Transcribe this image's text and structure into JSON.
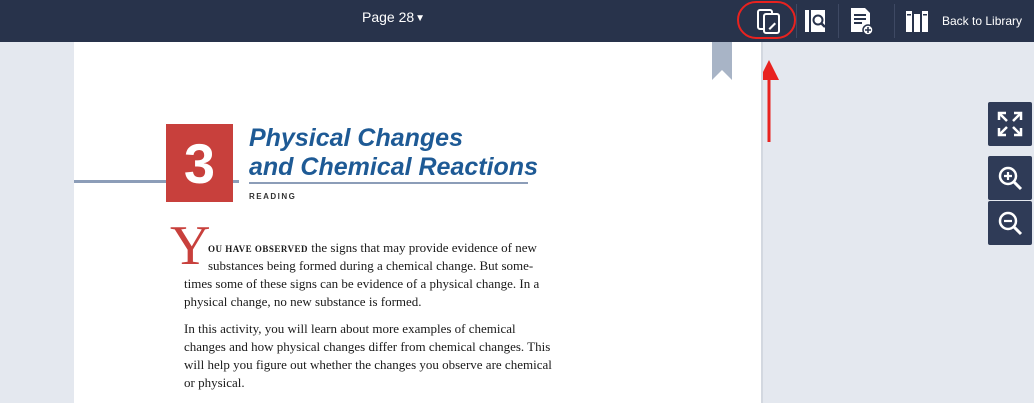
{
  "toolbar": {
    "page_label": "Page 28",
    "chevron": "⌄",
    "back_to_library": "Back to Library",
    "icons": [
      "annotations-icon",
      "search-in-book-icon",
      "add-note-icon",
      "library-icon"
    ]
  },
  "page": {
    "chapter_number": "3",
    "title_line1": "Physical Changes",
    "title_line2": "and Chemical Reactions",
    "section_label": "READING",
    "drop_cap": "Y",
    "intro_smallcaps": "OU HAVE OBSERVED",
    "p1_lines": [
      " the signs that may provide evidence of new",
      "substances being formed during a chemical change. But some-",
      "times some of these signs can be evidence of a physical change. In a",
      "physical change, no new substance is formed."
    ],
    "p2_lines": [
      "In this activity, you will learn about more examples of chemical",
      "changes and how physical changes differ from chemical changes. This",
      "will help you figure out whether the changes you observe are chemical",
      "or physical."
    ]
  },
  "side_controls": [
    "fullscreen-icon",
    "zoom-in-icon",
    "zoom-out-icon"
  ],
  "colors": {
    "toolbar_bg": "#28334b",
    "accent_red": "#c8403c",
    "title_blue": "#1e5a95",
    "highlight_red": "#e8221f"
  }
}
